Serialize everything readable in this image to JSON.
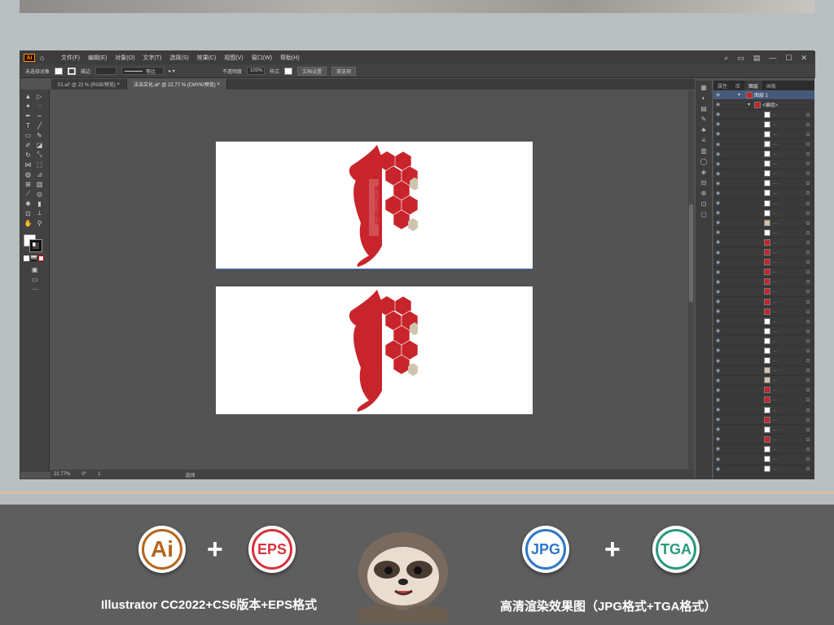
{
  "menubar": {
    "logo": "Ai",
    "menus": [
      "文件(F)",
      "编辑(E)",
      "对象(O)",
      "文字(T)",
      "选择(S)",
      "效果(C)",
      "视图(V)",
      "窗口(W)",
      "帮助(H)"
    ]
  },
  "controlbar": {
    "selection_label": "未选择对象",
    "stroke_label": "描边",
    "stroke_value": "",
    "profile_label": "等比",
    "opacity_label": "不透明度",
    "opacity_value": "100%",
    "style_label": "样式",
    "doc_setup_button": "文档设置",
    "preferences_button": "首选项"
  },
  "tabs": [
    {
      "label": "01.ai* @ 22 % (RGB/预览)"
    },
    {
      "label": "法治文化.ai* @ 22.77 % (CMYK/预览)"
    }
  ],
  "statusbar": {
    "zoom": "22.77%",
    "rotation": "0°",
    "artboard": "1",
    "tool": "选择"
  },
  "layers_panel": {
    "tabs": [
      "属性",
      "库",
      "图层",
      "画板"
    ],
    "active_tab": "图层",
    "top_layer": "图层 1",
    "group_label": "<编组>"
  },
  "design_text": {
    "line1": "推进法治建设",
    "line2": "弘扬法治精神"
  },
  "bottom": {
    "badge_ai": "Ai",
    "badge_eps": "EPS",
    "badge_jpg": "JPG",
    "badge_tga": "TGA",
    "plus": "+",
    "caption_left": "Illustrator CC2022+CS6版本+EPS格式",
    "caption_right": "高清渲染效果图（JPG格式+TGA格式）"
  },
  "colors": {
    "accent_red": "#c8242c",
    "ai_orange": "#b5651d",
    "eps_red": "#d6343d",
    "jpg_blue": "#2f77c8",
    "tga_green": "#2a9a7e"
  }
}
